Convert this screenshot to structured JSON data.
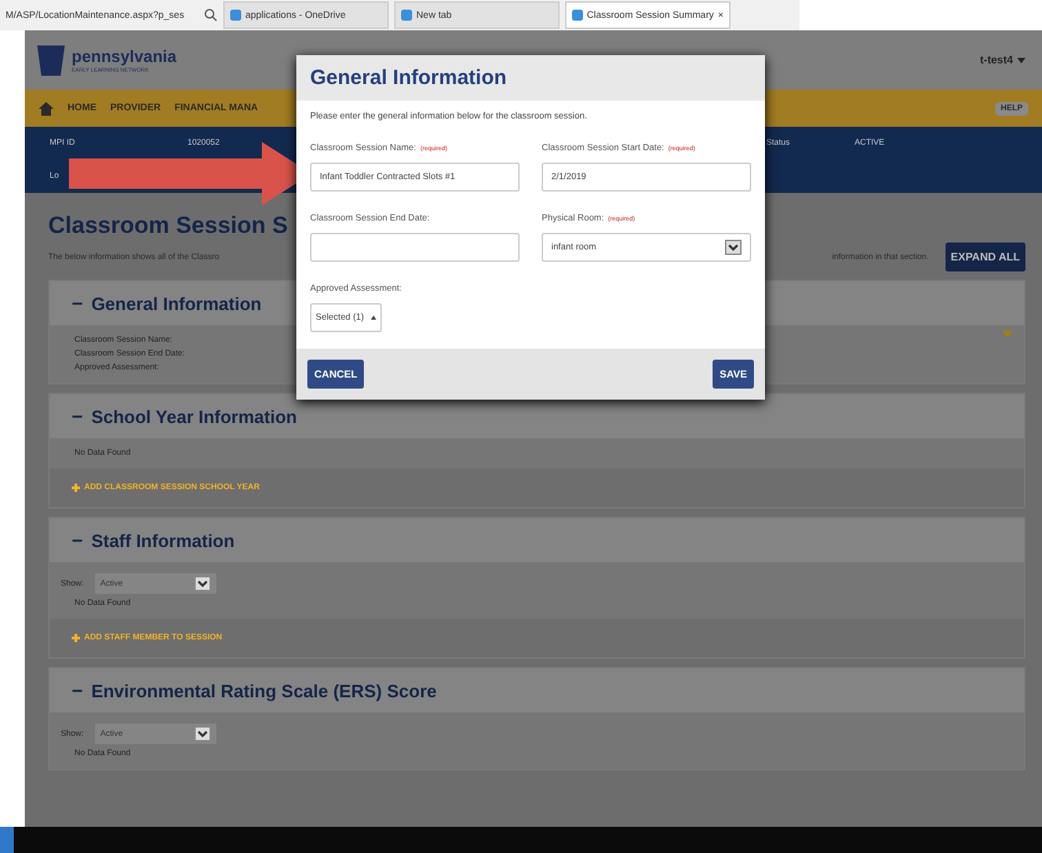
{
  "browser": {
    "address": "M/ASP/LocationMaintenance.aspx?p_ses",
    "tabs": [
      {
        "label": "applications - OneDrive",
        "selected": false
      },
      {
        "label": "New tab",
        "selected": false
      },
      {
        "label": "Classroom Session Summary",
        "selected": true,
        "close": "×"
      }
    ]
  },
  "header": {
    "logo_title": "pennsylvania",
    "logo_subtitle": "EARLY LEARNING NETWORK",
    "user_menu": "t-test4"
  },
  "nav": {
    "items": [
      "HOME",
      "PROVIDER",
      "FINANCIAL MANA"
    ],
    "help": "HELP"
  },
  "info_band": {
    "mpi_label": "MPI ID",
    "mpi_value": "1020052",
    "status_label": "Status",
    "status_value": "ACTIVE",
    "second_row": "Lo"
  },
  "page": {
    "title": "Classroom Session S",
    "description_left": "The below information shows all of the Classro",
    "description_right": "information in that section.",
    "expand_all": "EXPAND ALL"
  },
  "sections": [
    {
      "toggle": "−",
      "title": "General Information",
      "kind": "fields",
      "fields": [
        "Classroom Session Name:",
        "Classroom Session End Date:",
        "Approved Assessment:"
      ]
    },
    {
      "toggle": "−",
      "title": "School Year Information",
      "kind": "list",
      "empty": "No Data Found",
      "add": "ADD CLASSROOM SESSION SCHOOL YEAR"
    },
    {
      "toggle": "−",
      "title": "Staff Information",
      "kind": "list",
      "show_label": "Show:",
      "show_value": "Active",
      "empty": "No Data Found",
      "add": "ADD STAFF MEMBER TO SESSION"
    },
    {
      "toggle": "−",
      "title": "Environmental Rating Scale (ERS) Score",
      "kind": "list",
      "show_label": "Show:",
      "show_value": "Active",
      "empty": "No Data Found"
    }
  ],
  "modal": {
    "title": "General Information",
    "intro": "Please enter the general information below for the classroom session.",
    "fields": [
      {
        "kind": "text",
        "label": "Classroom Session Name:",
        "required": "(required)",
        "value": "Infant Toddler Contracted Slots #1"
      },
      {
        "kind": "text",
        "label": "Classroom Session Start Date:",
        "required": "(required)",
        "value": "2/1/2019"
      },
      {
        "kind": "text",
        "label": "Classroom Session End Date:"
      },
      {
        "kind": "select",
        "label": "Physical Room:",
        "required": "(required)",
        "value": "infant room"
      },
      {
        "kind": "multiselect",
        "label": "Approved Assessment:",
        "value": "Selected (1)"
      }
    ],
    "cancel": "CANCEL",
    "save": "SAVE"
  }
}
